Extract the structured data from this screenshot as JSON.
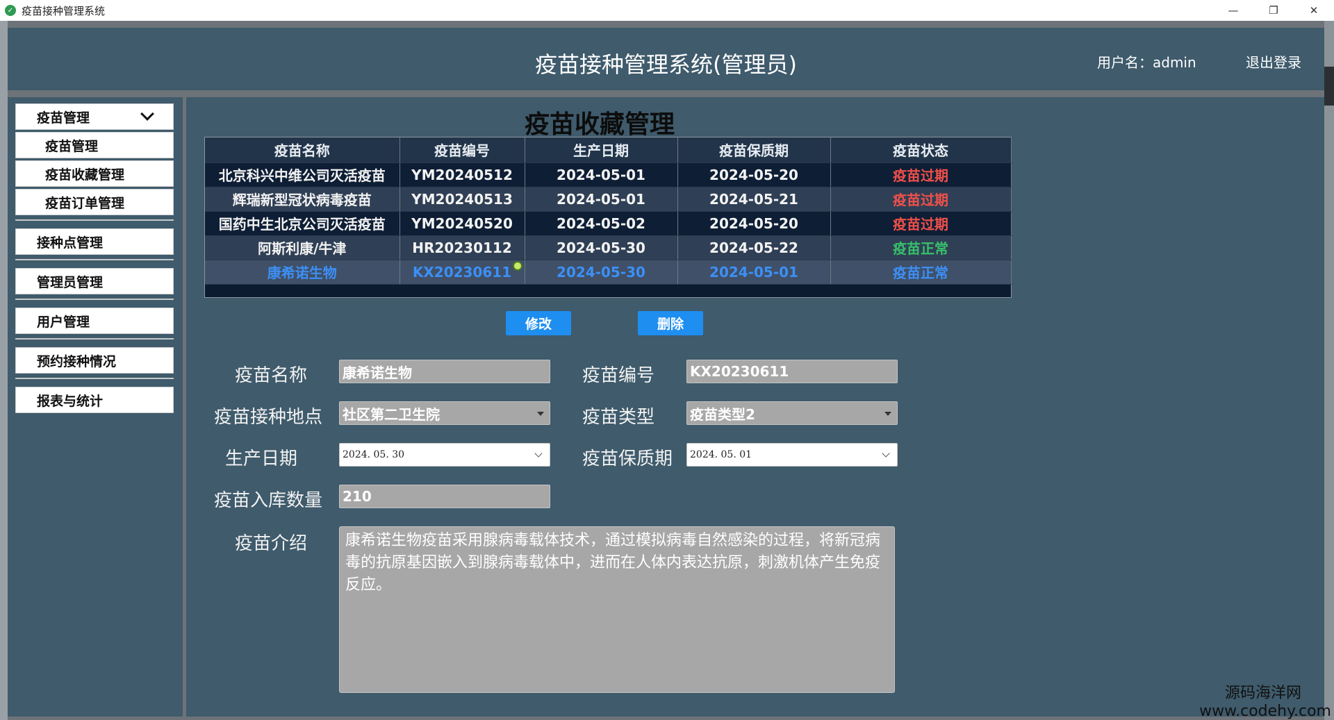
{
  "window": {
    "title": "疫苗接种管理系统",
    "controls": [
      "—",
      "❐",
      "✕"
    ]
  },
  "header": {
    "title": "疫苗接种管理系统(管理员)",
    "username": "用户名：admin",
    "logout": "退出登录"
  },
  "sidebar": {
    "items": [
      {
        "label": "疫苗管理",
        "expanded": true
      },
      {
        "label": "疫苗管理"
      },
      {
        "label": "疫苗收藏管理"
      },
      {
        "label": "疫苗订单管理"
      },
      {
        "label": "接种点管理"
      },
      {
        "label": "管理员管理"
      },
      {
        "label": "用户管理"
      },
      {
        "label": "预约接种情况"
      },
      {
        "label": "报表与统计"
      }
    ]
  },
  "main": {
    "section_title": "疫苗收藏管理",
    "table": {
      "headers": [
        "疫苗名称",
        "疫苗编号",
        "生产日期",
        "疫苗保质期",
        "疫苗状态"
      ],
      "rows": [
        [
          "北京科兴中维公司灭活疫苗",
          "YM20240512",
          "2024-05-01",
          "2024-05-20",
          "疫苗过期"
        ],
        [
          "辉瑞新型冠状病毒疫苗",
          "YM20240513",
          "2024-05-01",
          "2024-05-21",
          "疫苗过期"
        ],
        [
          "国药中生北京公司灭活疫苗",
          "YM20240520",
          "2024-05-02",
          "2024-05-20",
          "疫苗过期"
        ],
        [
          "阿斯利康/牛津",
          "HR20230112",
          "2024-05-30",
          "2024-05-22",
          "疫苗正常"
        ],
        [
          "康希诺生物",
          "KX20230611",
          "2024-05-30",
          "2024-05-01",
          "疫苗正常"
        ]
      ],
      "selected_row": 4
    },
    "buttons": {
      "edit": "修改",
      "delete": "删除"
    },
    "form": {
      "name_label": "疫苗名称",
      "name_value": "康希诺生物",
      "code_label": "疫苗编号",
      "code_value": "KX20230611",
      "site_label": "疫苗接种地点",
      "site_value": "社区第二卫生院",
      "type_label": "疫苗类型",
      "type_value": "疫苗类型2",
      "prod_label": "生产日期",
      "prod_value": "2024. 05. 30",
      "expiry_label": "疫苗保质期",
      "expiry_value": "2024. 05. 01",
      "qty_label": "疫苗入库数量",
      "qty_value": "210",
      "intro_label": "疫苗介绍",
      "intro_value": "康希诺生物疫苗采用腺病毒载体技术，通过模拟病毒自然感染的过程，将新冠病毒的抗原基因嵌入到腺病毒载体中，进而在人体内表达抗原，刺激机体产生免疫反应。"
    }
  },
  "watermark": {
    "line1": "源码海洋网",
    "line2": "www.codehy.com"
  },
  "colors": {
    "panel": "#3f5b6c",
    "table_bg": "#0d1b30",
    "button": "#1e8ef0",
    "expired": "#f0504a",
    "normal": "#37c06a",
    "selected_text": "#3d8ff5"
  }
}
